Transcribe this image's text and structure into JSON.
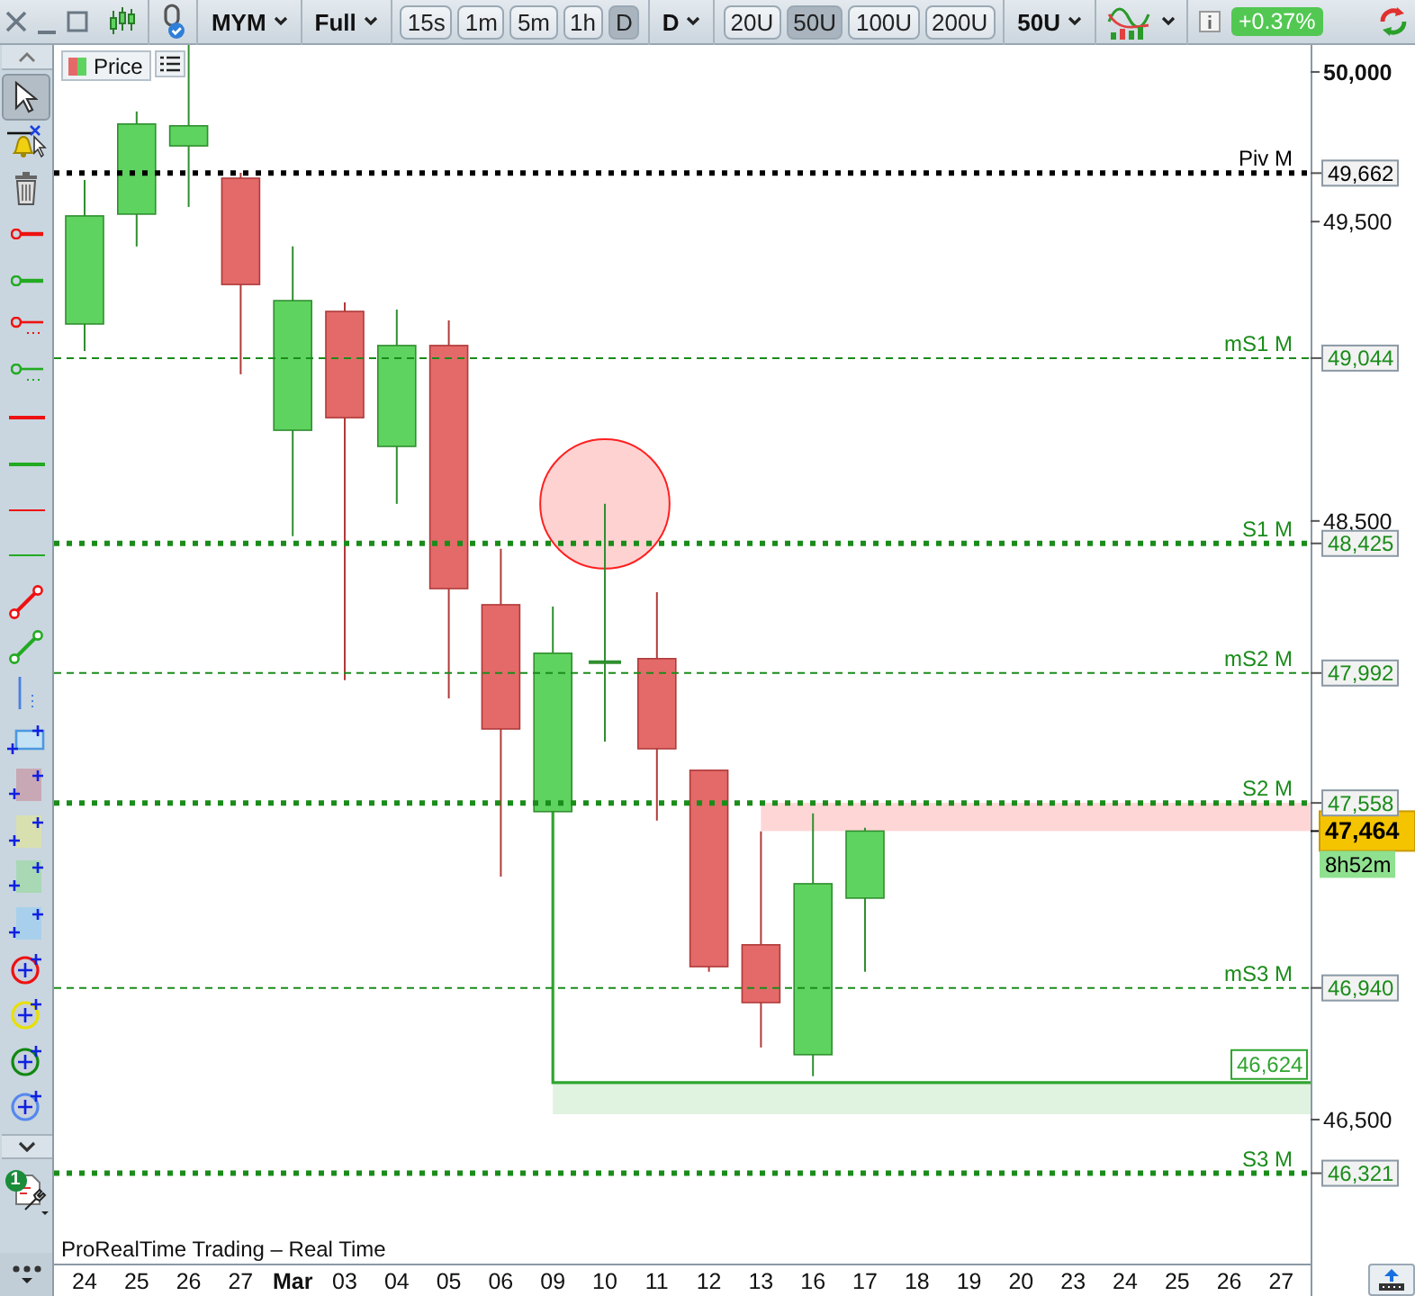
{
  "toolbar": {
    "symbol": "MYM",
    "chart_style": "Full",
    "timeframes": [
      {
        "label": "15s",
        "selected": false
      },
      {
        "label": "1m",
        "selected": false
      },
      {
        "label": "5m",
        "selected": false
      },
      {
        "label": "1h",
        "selected": false
      },
      {
        "label": "D",
        "selected": true
      }
    ],
    "period": "D",
    "units": [
      {
        "label": "20U",
        "selected": false
      },
      {
        "label": "50U",
        "selected": true
      },
      {
        "label": "100U",
        "selected": false
      },
      {
        "label": "200U",
        "selected": false
      }
    ],
    "units_menu": "50U",
    "change": "+0.37%"
  },
  "tools": [
    {
      "kind": "pointer",
      "selected": true
    },
    {
      "kind": "alert",
      "selected": false
    },
    {
      "kind": "trash",
      "selected": false
    },
    {
      "kind": "ray",
      "color": "#ee1111",
      "selected": false
    },
    {
      "kind": "ray",
      "color": "#22aa22",
      "selected": false
    },
    {
      "kind": "ray-dotted",
      "color": "#ee1111",
      "selected": false
    },
    {
      "kind": "ray-dotted",
      "color": "#22aa22",
      "selected": false
    },
    {
      "kind": "hline",
      "color": "#ee1111",
      "selected": false
    },
    {
      "kind": "hline",
      "color": "#22aa22",
      "selected": false
    },
    {
      "kind": "hline-thin",
      "color": "#ee1111",
      "selected": false
    },
    {
      "kind": "hline-thin",
      "color": "#22aa22",
      "selected": false
    },
    {
      "kind": "segment",
      "color": "#ee1111",
      "selected": false
    },
    {
      "kind": "segment",
      "color": "#22aa22",
      "selected": false
    },
    {
      "kind": "vline",
      "color": "#4a7fe0",
      "selected": false
    },
    {
      "kind": "rect-outline",
      "color": "#c4e2f6",
      "selected": false
    },
    {
      "kind": "rect",
      "color": "#c8a8b4",
      "selected": false
    },
    {
      "kind": "rect",
      "color": "#d8e0b0",
      "selected": false
    },
    {
      "kind": "rect",
      "color": "#a8d8b4",
      "selected": false
    },
    {
      "kind": "rect",
      "color": "#a8d0ec",
      "selected": false
    },
    {
      "kind": "circle",
      "color": "#ee1111",
      "selected": false
    },
    {
      "kind": "circle",
      "color": "#e8e000",
      "selected": false
    },
    {
      "kind": "circle",
      "color": "#118811",
      "selected": false
    },
    {
      "kind": "circle",
      "color": "#5588ee",
      "selected": false
    }
  ],
  "tools_badge": "1",
  "chart": {
    "footer": "ProRealTime Trading – Real Time",
    "last_price": "47,464",
    "countdown": "8h52m",
    "chart_data": {
      "type": "candlestick",
      "ylim": [
        46019,
        50090
      ],
      "categories": [
        "24",
        "25",
        "26",
        "27",
        "Mar",
        "03",
        "04",
        "05",
        "06",
        "09",
        "10",
        "11",
        "12",
        "13",
        "16",
        "17",
        "18",
        "19",
        "20",
        "23",
        "24",
        "25",
        "26",
        "27"
      ],
      "yticks": [
        {
          "value": 50000,
          "label": "50,000"
        },
        {
          "value": 49500,
          "label": "49,500"
        },
        {
          "value": 48500,
          "label": "48,500"
        },
        {
          "value": 46500,
          "label": "46,500"
        }
      ],
      "series": [
        {
          "name": "Price",
          "ohlc": [
            [
              49158,
              49639,
              49068,
              49519
            ],
            [
              49525,
              49868,
              49417,
              49826
            ],
            [
              49753,
              50090,
              49549,
              49820
            ],
            [
              49645,
              49663,
              48990,
              49290
            ],
            [
              48803,
              49417,
              48449,
              49236
            ],
            [
              49200,
              49230,
              47968,
              48845
            ],
            [
              48749,
              49206,
              48557,
              49086
            ],
            [
              49086,
              49170,
              47907,
              48274
            ],
            [
              48220,
              48407,
              47312,
              47805
            ],
            [
              47529,
              48214,
              47529,
              48058
            ],
            [
              48028,
              48557,
              47763,
              48028
            ],
            [
              48040,
              48262,
              47499,
              47739
            ],
            [
              47667,
              47667,
              46994,
              47011
            ],
            [
              47084,
              47463,
              46741,
              46891
            ],
            [
              46717,
              47523,
              46645,
              47288
            ],
            [
              47240,
              47475,
              46994,
              47464
            ],
            null,
            null,
            null,
            null,
            null,
            null,
            null,
            null
          ]
        }
      ]
    },
    "date_axis": [
      {
        "month_start": false
      },
      {
        "month_start": false
      },
      {
        "month_start": false
      },
      {
        "month_start": false
      },
      {
        "month_start": true
      },
      {
        "month_start": false
      },
      {
        "month_start": false
      },
      {
        "month_start": false
      },
      {
        "month_start": false
      },
      {
        "month_start": false
      },
      {
        "month_start": false
      },
      {
        "month_start": false
      },
      {
        "month_start": false
      },
      {
        "month_start": false
      },
      {
        "month_start": false
      },
      {
        "month_start": false
      },
      {
        "month_start": false
      },
      {
        "month_start": false
      },
      {
        "month_start": false
      },
      {
        "month_start": false
      },
      {
        "month_start": false
      },
      {
        "month_start": false
      },
      {
        "month_start": false
      },
      {
        "month_start": false
      }
    ],
    "levels": [
      {
        "label": "Piv M",
        "value_label": "49,662",
        "kind": "dotted",
        "color": "#000000"
      },
      {
        "label": "mS1 M",
        "value_label": "49,044",
        "kind": "dashed",
        "color": "#1a8c1a"
      },
      {
        "label": "S1 M",
        "value_label": "48,425",
        "kind": "dotted",
        "color": "#1a8c1a"
      },
      {
        "label": "mS2 M",
        "value_label": "47,992",
        "kind": "dashed",
        "color": "#1a8c1a"
      },
      {
        "label": "S2 M",
        "value_label": "47,558",
        "kind": "dotted",
        "color": "#1a8c1a"
      },
      {
        "label": "mS3 M",
        "value_label": "46,940",
        "kind": "dashed",
        "color": "#1a8c1a"
      },
      {
        "label": "S3 M",
        "value_label": "46,321",
        "kind": "dotted",
        "color": "#1a8c1a"
      }
    ],
    "drawings": [
      {
        "kind": "zone",
        "color": "#ffd6d6"
      },
      {
        "kind": "support",
        "label": "46,624",
        "color": "#2fa52f"
      },
      {
        "kind": "circle",
        "color": "#ff2020"
      }
    ]
  }
}
